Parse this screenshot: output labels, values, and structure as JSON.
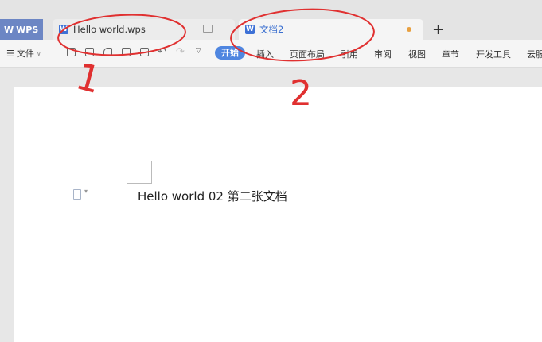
{
  "tabbar": {
    "wps_label": "WPS",
    "tabs": [
      {
        "label": "Hello world.wps"
      },
      {
        "label": "文档2"
      }
    ],
    "new_tab_label": "+"
  },
  "toolbar": {
    "file_menu": "文件",
    "active_tab": "开始",
    "ribbon_tabs": [
      "插入",
      "页面布局",
      "引用",
      "审阅",
      "视图",
      "章节",
      "开发工具",
      "云服"
    ]
  },
  "document": {
    "text": "Hello world 02 第二张文档"
  },
  "annotations": {
    "label_1": "1",
    "label_2": "2",
    "color": "#e03030"
  }
}
